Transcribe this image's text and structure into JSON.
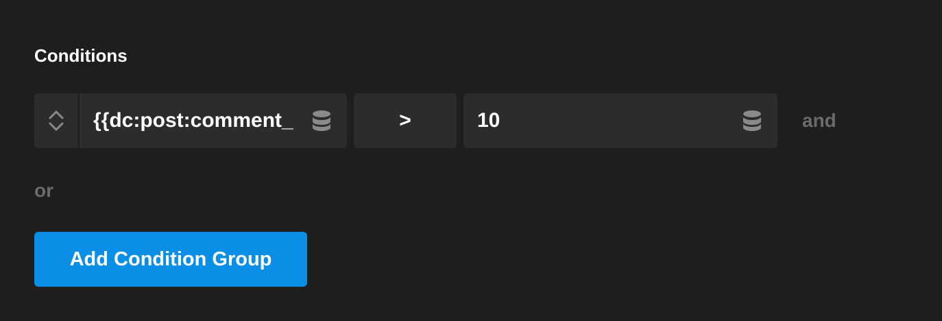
{
  "section": {
    "title": "Conditions"
  },
  "condition": {
    "key_value": "{{dc:post:comment_",
    "operator": ">",
    "compare_value": "10",
    "and_label": "and",
    "key_icon": "database-icon",
    "value_icon": "database-icon",
    "handle_icon": "sort-handle-icon"
  },
  "or_label": "or",
  "add_group_label": "Add Condition Group",
  "colors": {
    "background": "#1e1e1f",
    "field_background": "#2c2c2d",
    "muted_text": "#6b6b6c",
    "accent": "#0b8fe6",
    "icon": "#8a8a8b"
  }
}
